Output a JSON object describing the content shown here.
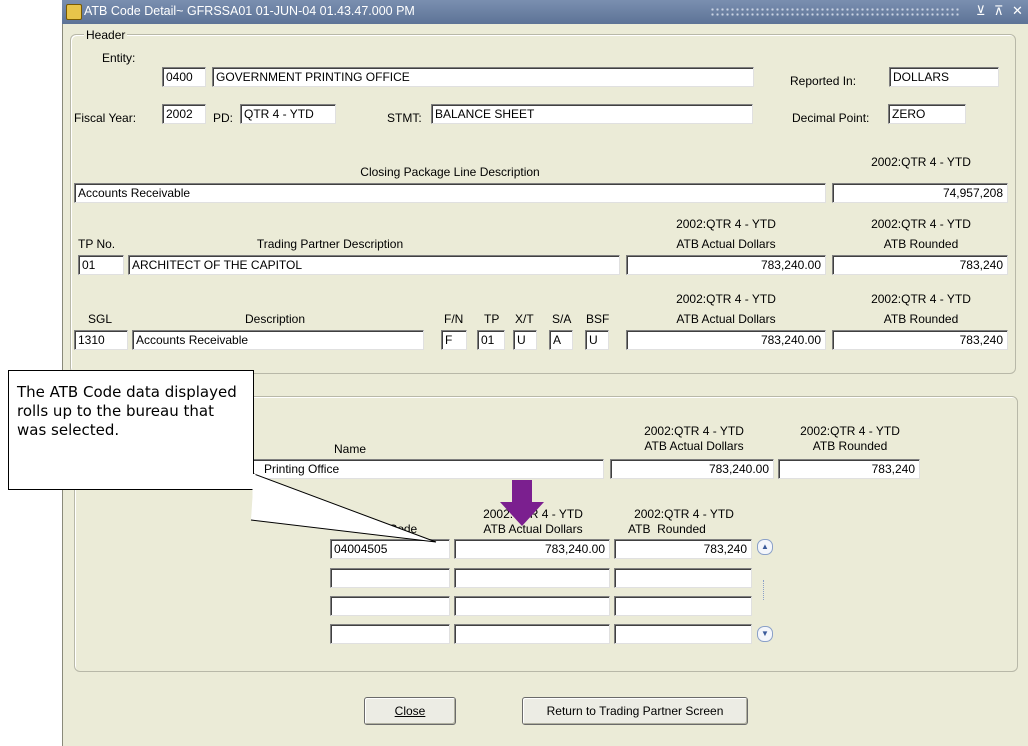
{
  "window": {
    "title": "ATB Code Detail~ GFRSSA01  01-JUN-04 01.43.47.000 PM",
    "controls": [
      "⊻",
      "⊼",
      "✕"
    ]
  },
  "header": {
    "group_label": "Header",
    "entity_label": "Entity:",
    "entity_code": "0400",
    "entity_name": "GOVERNMENT PRINTING OFFICE",
    "reported_in_label": "Reported In:",
    "reported_in": "DOLLARS",
    "fiscal_year_label": "Fiscal Year:",
    "fiscal_year": "2002",
    "pd_label": "PD:",
    "pd": "QTR 4 - YTD",
    "stmt_label": "STMT:",
    "stmt": "BALANCE SHEET",
    "decimal_point_label": "Decimal Point:",
    "decimal_point": "ZERO"
  },
  "closing_package": {
    "desc_header": "Closing Package Line Description",
    "amount_header": "2002:QTR 4 - YTD",
    "description": "Accounts Receivable",
    "amount": "74,957,208"
  },
  "trading_partner": {
    "tp_no_header": "TP No.",
    "desc_header": "Trading Partner Description",
    "actual_header_1": "2002:QTR 4 - YTD",
    "actual_header_2": "ATB Actual Dollars",
    "rounded_header_1": "2002:QTR 4 - YTD",
    "rounded_header_2": "ATB Rounded",
    "tp_no": "01",
    "description": "ARCHITECT OF THE CAPITOL",
    "actual": "783,240.00",
    "rounded": "783,240"
  },
  "sgl": {
    "sgl_header": "SGL",
    "desc_header": "Description",
    "fn_header": "F/N",
    "tp_header": "TP",
    "xt_header": "X/T",
    "sa_header": "S/A",
    "bsf_header": "BSF",
    "actual_header_1": "2002:QTR 4 - YTD",
    "actual_header_2": "ATB Actual Dollars",
    "rounded_header_1": "2002:QTR 4 - YTD",
    "rounded_header_2": "ATB Rounded",
    "sgl": "1310",
    "description": "Accounts Receivable",
    "fn": "F",
    "tp": "01",
    "xt": "U",
    "sa": "A",
    "bsf": "U",
    "actual": "783,240.00",
    "rounded": "783,240"
  },
  "bureau": {
    "name_header": "Name",
    "actual_header_1": "2002:QTR 4 - YTD",
    "actual_header_2": "ATB Actual Dollars",
    "rounded_header_1": "2002:QTR 4 - YTD",
    "rounded_header_2": "ATB Rounded",
    "name": "Printing Office",
    "actual": "783,240.00",
    "rounded": "783,240"
  },
  "atb_table": {
    "code_header": "ATB Code",
    "actual_header_1": "2002:QTR 4 - YTD",
    "actual_header_2": "ATB Actual Dollars",
    "rounded_header_1": "2002:QTR 4 - YTD",
    "rounded_header_2": "ATB  Rounded",
    "rows": [
      {
        "code": "04004505",
        "actual": "783,240.00",
        "rounded": "783,240"
      },
      {
        "code": "",
        "actual": "",
        "rounded": ""
      },
      {
        "code": "",
        "actual": "",
        "rounded": ""
      },
      {
        "code": "",
        "actual": "",
        "rounded": ""
      }
    ]
  },
  "buttons": {
    "close": "Close",
    "return": "Return to Trading Partner Screen"
  },
  "callout": {
    "text": "The ATB Code data displayed rolls up to the bureau that was selected."
  },
  "colors": {
    "window_bg": "#ebebd7",
    "titlebar": "#6b80a4",
    "arrow": "#7b1f8f"
  }
}
